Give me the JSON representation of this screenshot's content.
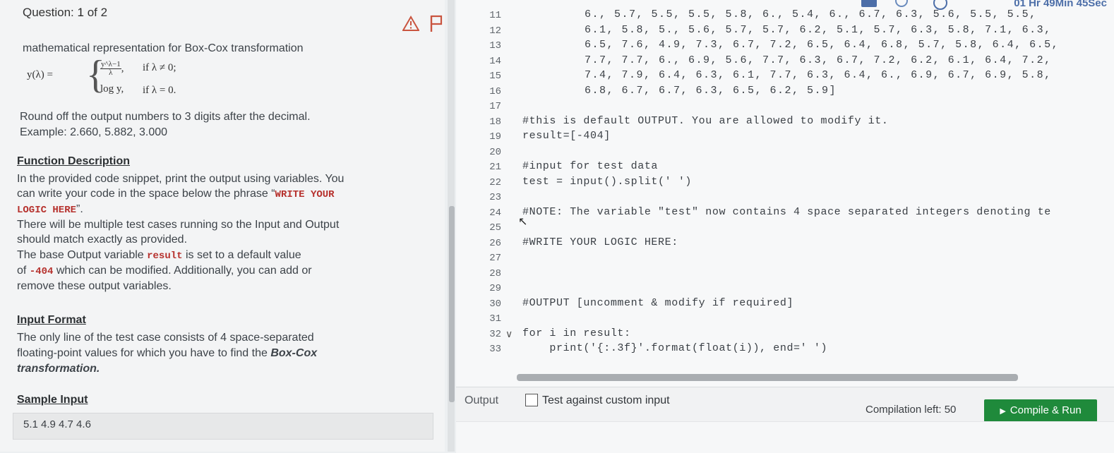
{
  "question": {
    "label": "Question:",
    "current": "1",
    "of": "of 2"
  },
  "problem": {
    "intro": "mathematical representation for Box-Cox transformation",
    "formula": {
      "lhs": "y(λ) =",
      "num": "y^λ−1",
      "den": "λ",
      "case1_cond": "if λ ≠ 0;",
      "case2_expr": "log y,",
      "case2_cond": "if λ = 0."
    },
    "round_text": "Round off the output numbers to 3 digits after the decimal.",
    "example_text": "Example: 2.660, 5.882, 3.000",
    "fd_title": "Function Description",
    "fd_line1": "In the provided code snippet, print the output using variables. You",
    "fd_line2": "can write your code in the space below the phrase “",
    "fd_phrase1": "WRITE YOUR",
    "fd_phrase2": "LOGIC HERE",
    "fd_line3": "”.",
    "fd_line4": "There will be multiple test cases running so the Input and Output",
    "fd_line5": "should match exactly as provided.",
    "fd_line6a": "The base Output variable ",
    "fd_result": "result",
    "fd_line6b": " is set to a default value",
    "fd_line7a": "of ",
    "fd_404": "-404",
    "fd_line7b": " which can be modified. Additionally, you can add or",
    "fd_line8": "remove these output variables.",
    "if_title": "Input Format",
    "if_line1": "The only line of the test case consists of 4 space-separated",
    "if_line2a": "floating-point values for which you have to find the ",
    "if_bold": "Box-Cox",
    "if_line3": "transformation.",
    "si_title": "Sample Input",
    "sample_input": "5.1 4.9 4.7 4.6"
  },
  "editor": {
    "timer": "01 Hr 49Min 45Sec",
    "lines": [
      {
        "n": "11",
        "text": "6., 5.7, 5.5, 5.5, 5.8, 6., 5.4, 6., 6.7, 6.3, 5.6, 5.5, 5.5,"
      },
      {
        "n": "12",
        "text": "6.1, 5.8, 5., 5.6, 5.7, 5.7, 6.2, 5.1, 5.7, 6.3, 5.8, 7.1, 6.3,"
      },
      {
        "n": "13",
        "text": "6.5, 7.6, 4.9, 7.3, 6.7, 7.2, 6.5, 6.4, 6.8, 5.7, 5.8, 6.4, 6.5,"
      },
      {
        "n": "14",
        "text": "7.7, 7.7, 6., 6.9, 5.6, 7.7, 6.3, 6.7, 7.2, 6.2, 6.1, 6.4, 7.2,"
      },
      {
        "n": "15",
        "text": "7.4, 7.9, 6.4, 6.3, 6.1, 7.7, 6.3, 6.4, 6., 6.9, 6.7, 6.9, 5.8,"
      },
      {
        "n": "16",
        "text": "6.8, 6.7, 6.7, 6.3, 6.5, 6.2, 5.9]"
      },
      {
        "n": "17",
        "text": ""
      },
      {
        "n": "18",
        "text": "#this is default OUTPUT. You are allowed to modify it."
      },
      {
        "n": "19",
        "text": "result=[-404]"
      },
      {
        "n": "20",
        "text": ""
      },
      {
        "n": "21",
        "text": "#input for test data"
      },
      {
        "n": "22",
        "text": "test = input().split(' ')"
      },
      {
        "n": "23",
        "text": ""
      },
      {
        "n": "24",
        "text": "#NOTE: The variable \"test\" now contains 4 space separated integers denoting te"
      },
      {
        "n": "25",
        "text": ""
      },
      {
        "n": "26",
        "text": "#WRITE YOUR LOGIC HERE:"
      },
      {
        "n": "27",
        "text": ""
      },
      {
        "n": "28",
        "text": ""
      },
      {
        "n": "29",
        "text": ""
      },
      {
        "n": "30",
        "text": "#OUTPUT [uncomment & modify if required]"
      },
      {
        "n": "31",
        "text": ""
      },
      {
        "n": "32",
        "text": "for i in result:"
      },
      {
        "n": "33",
        "text": "    print('{:.3f}'.format(float(i)), end=' ')"
      }
    ]
  },
  "bottom": {
    "output_label": "Output",
    "custom_input_label": "Test against custom input",
    "compilation_left": "Compilation left: 50",
    "run_label": "Compile & Run"
  },
  "icons": [
    "warning-icon",
    "flag-icon",
    "grid-icon",
    "clock-icon",
    "timer-icon",
    "play-icon",
    "chevron-down-icon"
  ],
  "colors": {
    "accent_red": "#b6312d",
    "run_green": "#1f8a3b",
    "timer_blue": "#4c6ea8"
  }
}
